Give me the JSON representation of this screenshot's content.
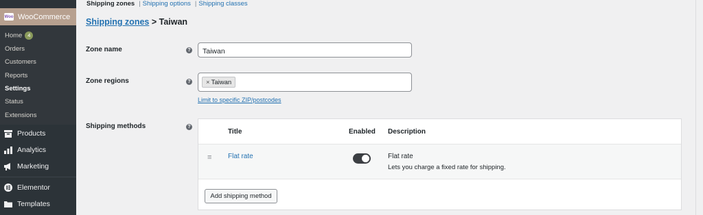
{
  "sidebar": {
    "brand": {
      "logo": "Woo",
      "title": "WooCommerce"
    },
    "submenu": [
      {
        "label": "Home",
        "badge": "4"
      },
      {
        "label": "Orders"
      },
      {
        "label": "Customers"
      },
      {
        "label": "Reports"
      },
      {
        "label": "Settings",
        "active": true
      },
      {
        "label": "Status"
      },
      {
        "label": "Extensions"
      }
    ],
    "menu": [
      {
        "label": "Products",
        "icon": "archive-icon"
      },
      {
        "label": "Analytics",
        "icon": "bar-chart-icon"
      },
      {
        "label": "Marketing",
        "icon": "megaphone-icon"
      },
      {
        "label": "Elementor",
        "icon": "elementor-icon"
      },
      {
        "label": "Templates",
        "icon": "folder-icon"
      }
    ]
  },
  "tabs": {
    "current": "Shipping zones",
    "options": "Shipping options",
    "classes": "Shipping classes",
    "separator": "|"
  },
  "breadcrumb": {
    "parent": "Shipping zones",
    "current": "> Taiwan"
  },
  "form": {
    "zone_name": {
      "label": "Zone name",
      "value": "Taiwan"
    },
    "zone_regions": {
      "label": "Zone regions",
      "chip": "Taiwan",
      "chip_remove": "×",
      "limit_link": "Limit to specific ZIP/postcodes"
    },
    "help_icon": "?"
  },
  "shipping_methods": {
    "label": "Shipping methods",
    "headers": {
      "title": "Title",
      "enabled": "Enabled",
      "description": "Description"
    },
    "rows": [
      {
        "title": "Flat rate",
        "enabled": true,
        "desc_title": "Flat rate",
        "desc_text": "Lets you charge a fixed rate for shipping.",
        "drag": "≡"
      }
    ],
    "add_button": "Add shipping method"
  },
  "colors": {
    "accent": "#2271b1",
    "brand": "#b7a08f",
    "sidebar": "#2c3338",
    "toggle_on": "#3c3f43"
  }
}
